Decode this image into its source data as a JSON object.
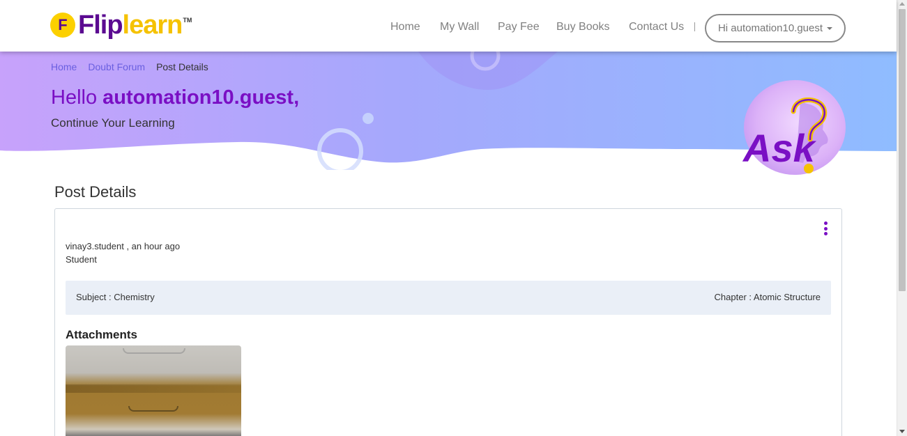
{
  "header": {
    "logo_icon": "F",
    "logo_part1": "Flip",
    "logo_part2": "learn",
    "logo_tm": "TM",
    "nav": [
      {
        "label": "Home"
      },
      {
        "label": "My Wall"
      },
      {
        "label": "Pay Fee"
      },
      {
        "label": "Buy Books"
      },
      {
        "label": "Contact Us"
      }
    ],
    "user_menu_label": "Hi automation10.guest"
  },
  "breadcrumb": {
    "items": [
      "Home",
      "Doubt Forum",
      "Post Details"
    ]
  },
  "banner": {
    "greeting_prefix": "Hello ",
    "username": "automation10.guest,",
    "subtitle": "Continue Your Learning",
    "badge_text": "Ask",
    "badge_icon": "question-head-icon"
  },
  "post": {
    "section_title": "Post Details",
    "author_line": "vinay3.student , an hour ago",
    "role": "Student",
    "subject": "Subject : Chemistry",
    "chapter": "Chapter : Atomic Structure",
    "attachments_title": "Attachments",
    "menu_icon": "kebab-menu-icon"
  },
  "colors": {
    "brand_purple": "#7a0fc4",
    "brand_yellow": "#f5c200",
    "banner_start": "#c7a2fb",
    "banner_end": "#8fbcff",
    "info_bar_bg": "#eaeff7"
  }
}
